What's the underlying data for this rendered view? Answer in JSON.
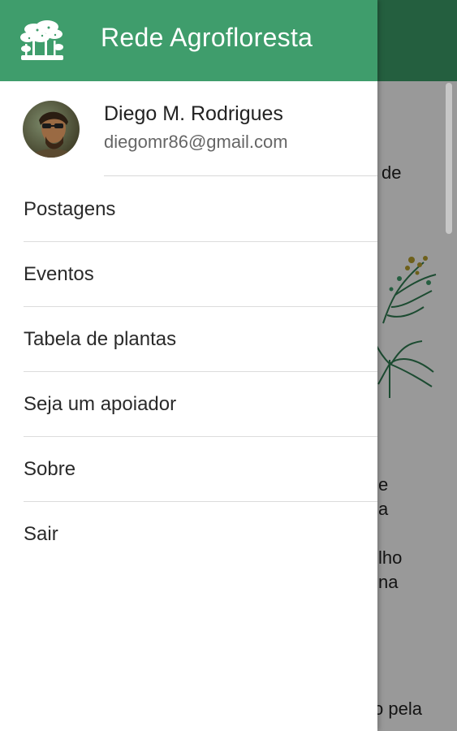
{
  "app": {
    "title": "Rede Agrofloresta"
  },
  "user": {
    "name": "Diego M. Rodrigues",
    "email": "diegomr86@gmail.com"
  },
  "menu": {
    "items": [
      {
        "label": "Postagens"
      },
      {
        "label": "Eventos"
      },
      {
        "label": "Tabela de plantas"
      },
      {
        "label": "Seja um apoiador"
      },
      {
        "label": "Sobre"
      },
      {
        "label": "Sair"
      }
    ]
  },
  "background": {
    "fragments": [
      "de",
      "e",
      "a",
      "lho",
      "na",
      "o pela"
    ]
  },
  "colors": {
    "header": "#3f9d6c",
    "accent_green": "#2f7d52",
    "scrim": "rgba(0,0,0,0.40)"
  }
}
